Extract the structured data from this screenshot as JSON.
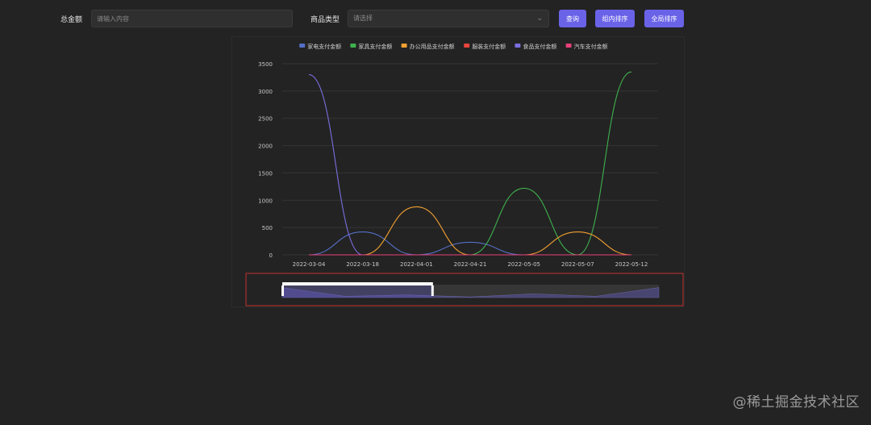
{
  "filters": {
    "total_label": "总金额",
    "total_placeholder": "请输入内容",
    "type_label": "商品类型",
    "type_placeholder": "请选择"
  },
  "buttons": {
    "query": "查询",
    "group_sort": "组内排序",
    "global_sort": "全局排序"
  },
  "watermark": "@稀土掘金技术社区",
  "colors": {
    "accent": "#6a63e8",
    "zoom_border": "#c0302f"
  },
  "chart_data": {
    "type": "line",
    "x": [
      "2022-03-04",
      "2022-03-18",
      "2022-04-01",
      "2022-04-21",
      "2022-05-05",
      "2022-05-07",
      "2022-05-12"
    ],
    "ylim": [
      0,
      3500
    ],
    "yticks": [
      0,
      500,
      1000,
      1500,
      2000,
      2500,
      3000,
      3500
    ],
    "grid": true,
    "legend_position": "top",
    "series": [
      {
        "name": "家电支付金额",
        "color": "#5470c6",
        "values": [
          0,
          420,
          0,
          230,
          0,
          0,
          0
        ]
      },
      {
        "name": "家具支付金额",
        "color": "#3fb24f",
        "values": [
          0,
          0,
          0,
          0,
          1220,
          0,
          3350
        ]
      },
      {
        "name": "办公用品支付金额",
        "color": "#f0a030",
        "values": [
          0,
          0,
          880,
          0,
          0,
          420,
          0
        ]
      },
      {
        "name": "服装支付金额",
        "color": "#e8453c",
        "values": [
          0,
          0,
          0,
          0,
          0,
          0,
          0
        ]
      },
      {
        "name": "食品支付金额",
        "color": "#7b6fe0",
        "values": [
          3300,
          0,
          0,
          0,
          0,
          0,
          0
        ]
      },
      {
        "name": "汽车支付金额",
        "color": "#e8407a",
        "values": [
          0,
          0,
          0,
          0,
          0,
          0,
          0
        ]
      }
    ],
    "zoom": {
      "start": 0,
      "end": 0.4
    }
  }
}
